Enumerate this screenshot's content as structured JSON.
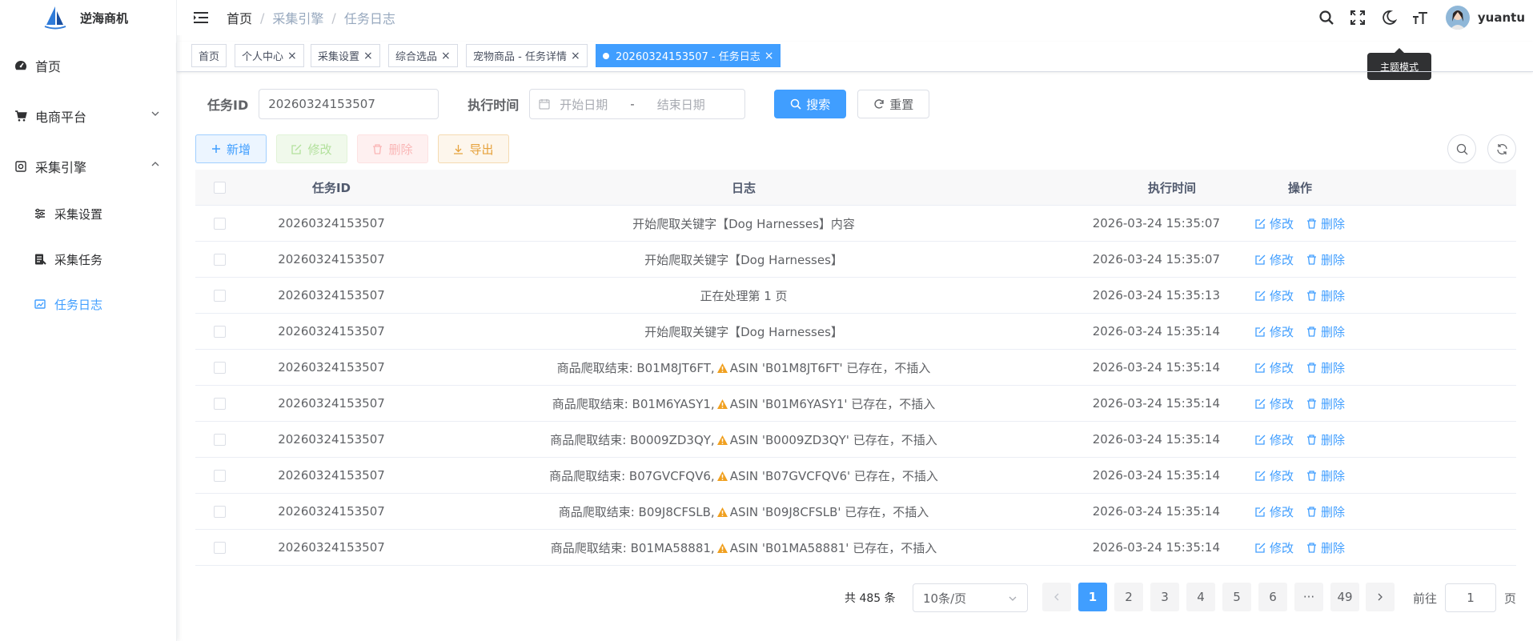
{
  "app": {
    "title": "逆海商机"
  },
  "colors": {
    "primary": "#409eff",
    "warning": "#e6a23c",
    "danger": "#f56c6c",
    "success": "#67c23a"
  },
  "sidebar": {
    "items": [
      {
        "label": "首页",
        "icon": "dashboard-icon"
      },
      {
        "label": "电商平台",
        "icon": "cart-icon"
      },
      {
        "label": "采集引擎",
        "icon": "engine-icon"
      }
    ],
    "subitems": [
      {
        "label": "采集设置",
        "icon": "sliders-icon"
      },
      {
        "label": "采集任务",
        "icon": "task-icon"
      },
      {
        "label": "任务日志",
        "icon": "log-icon"
      }
    ]
  },
  "header": {
    "breadcrumb": [
      "首页",
      "采集引擎",
      "任务日志"
    ],
    "username": "yuantu",
    "tooltip": "主题模式"
  },
  "tags": [
    "首页",
    "个人中心",
    "采集设置",
    "综合选品",
    "宠物商品 - 任务详情",
    "20260324153507 - 任务日志"
  ],
  "search": {
    "task_id_label": "任务ID",
    "task_id_value": "20260324153507",
    "time_label": "执行时间",
    "start_placeholder": "开始日期",
    "range_sep": "-",
    "end_placeholder": "结束日期",
    "search_btn": "搜索",
    "reset_btn": "重置"
  },
  "toolbar": {
    "add": "新增",
    "edit": "修改",
    "delete": "删除",
    "export": "导出"
  },
  "table": {
    "headers": {
      "id": "任务ID",
      "log": "日志",
      "time": "执行时间",
      "op": "操作"
    },
    "op_edit": "修改",
    "op_delete": "删除",
    "rows": [
      {
        "id": "20260324153507",
        "pre": "开始爬取关键字【Dog Harnesses】内容",
        "post": "",
        "warn": false,
        "time": "2026-03-24 15:35:07"
      },
      {
        "id": "20260324153507",
        "pre": "开始爬取关键字【Dog Harnesses】",
        "post": "",
        "warn": false,
        "time": "2026-03-24 15:35:07"
      },
      {
        "id": "20260324153507",
        "pre": "正在处理第 1 页",
        "post": "",
        "warn": false,
        "time": "2026-03-24 15:35:13"
      },
      {
        "id": "20260324153507",
        "pre": "开始爬取关键字【Dog Harnesses】",
        "post": "",
        "warn": false,
        "time": "2026-03-24 15:35:14"
      },
      {
        "id": "20260324153507",
        "pre": "商品爬取结束: B01M8JT6FT,",
        "post": "ASIN 'B01M8JT6FT' 已存在，不插入",
        "warn": true,
        "time": "2026-03-24 15:35:14"
      },
      {
        "id": "20260324153507",
        "pre": "商品爬取结束: B01M6YASY1,",
        "post": "ASIN 'B01M6YASY1' 已存在，不插入",
        "warn": true,
        "time": "2026-03-24 15:35:14"
      },
      {
        "id": "20260324153507",
        "pre": "商品爬取结束: B0009ZD3QY,",
        "post": "ASIN 'B0009ZD3QY' 已存在，不插入",
        "warn": true,
        "time": "2026-03-24 15:35:14"
      },
      {
        "id": "20260324153507",
        "pre": "商品爬取结束: B07GVCFQV6,",
        "post": "ASIN 'B07GVCFQV6' 已存在，不插入",
        "warn": true,
        "time": "2026-03-24 15:35:14"
      },
      {
        "id": "20260324153507",
        "pre": "商品爬取结束: B09J8CFSLB,",
        "post": "ASIN 'B09J8CFSLB' 已存在，不插入",
        "warn": true,
        "time": "2026-03-24 15:35:14"
      },
      {
        "id": "20260324153507",
        "pre": "商品爬取结束: B01MA58881,",
        "post": "ASIN 'B01MA58881' 已存在，不插入",
        "warn": true,
        "time": "2026-03-24 15:35:14"
      }
    ]
  },
  "pagination": {
    "total": "共 485 条",
    "page_size": "10条/页",
    "pages": [
      "1",
      "2",
      "3",
      "4",
      "5",
      "6",
      "···",
      "49"
    ],
    "current": "1",
    "goto_label": "前往",
    "goto_value": "1",
    "goto_suffix": "页"
  }
}
